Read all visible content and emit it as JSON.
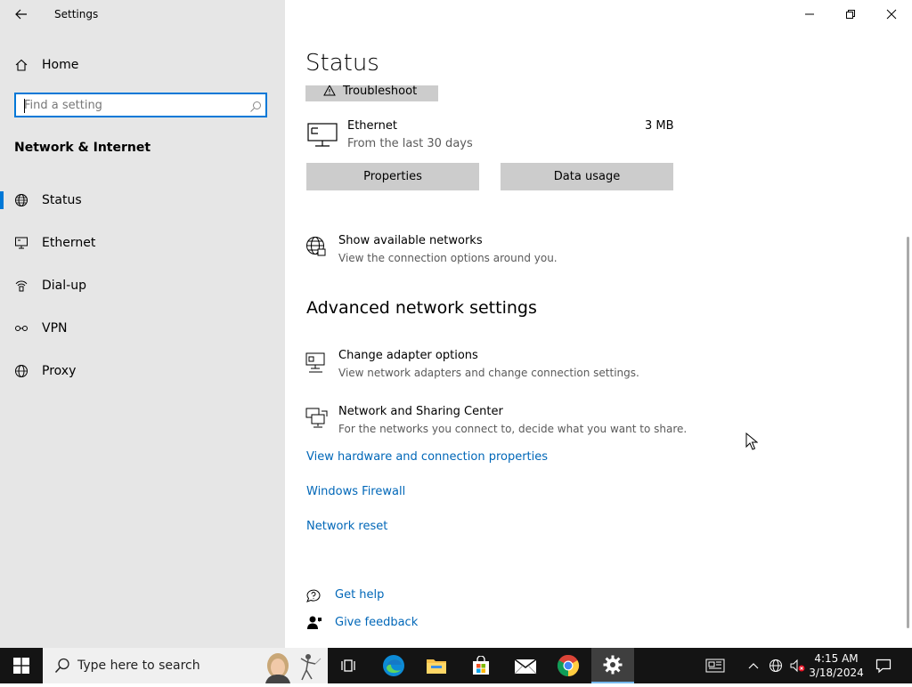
{
  "window": {
    "title": "Settings"
  },
  "sidebar": {
    "home_label": "Home",
    "search_placeholder": "Find a setting",
    "section_title": "Network & Internet",
    "items": [
      {
        "label": "Status",
        "icon": "globe-icon",
        "selected": true
      },
      {
        "label": "Ethernet",
        "icon": "ethernet-icon",
        "selected": false
      },
      {
        "label": "Dial-up",
        "icon": "dialup-icon",
        "selected": false
      },
      {
        "label": "VPN",
        "icon": "vpn-icon",
        "selected": false
      },
      {
        "label": "Proxy",
        "icon": "globe-icon",
        "selected": false
      }
    ]
  },
  "main": {
    "page_title": "Status",
    "troubleshoot_label": "Troubleshoot",
    "ethernet": {
      "name": "Ethernet",
      "subtitle": "From the last 30 days",
      "usage": "3 MB"
    },
    "properties_label": "Properties",
    "data_usage_label": "Data usage",
    "show_networks": {
      "title": "Show available networks",
      "subtitle": "View the connection options around you."
    },
    "advanced_title": "Advanced network settings",
    "change_adapter": {
      "title": "Change adapter options",
      "subtitle": "View network adapters and change connection settings."
    },
    "sharing_center": {
      "title": "Network and Sharing Center",
      "subtitle": "For the networks you connect to, decide what you want to share."
    },
    "links": {
      "hardware": "View hardware and connection properties",
      "firewall": "Windows Firewall",
      "reset": "Network reset"
    },
    "help": {
      "get_help": "Get help",
      "give_feedback": "Give feedback"
    }
  },
  "taskbar": {
    "search_placeholder": "Type here to search",
    "time": "4:15 AM",
    "date": "3/18/2024"
  },
  "colors": {
    "accent": "#0078d7",
    "link": "#0067b8",
    "sidebar_bg": "#e6e6e6",
    "taskbar_bg": "#141414"
  }
}
